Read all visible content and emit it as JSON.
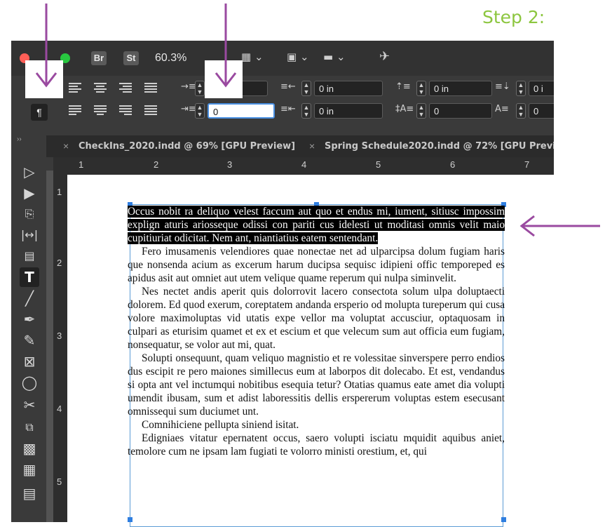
{
  "step_label": "Step 2:",
  "appbar": {
    "bridge_badge": "Br",
    "stock_badge": "St",
    "zoom": "60.3%"
  },
  "control_panel": {
    "left_indent": "0 in",
    "right_indent": "0 in",
    "first_line_indent": "0",
    "last_line_indent": "0 in",
    "space_before": "0 in",
    "space_after": "0 in",
    "drop_cap_lines": "0 i",
    "drop_cap_chars": "0",
    "drop_cap_prefix": "0"
  },
  "tabs": [
    {
      "label": "CheckIns_2020.indd @ 69% [GPU Preview]"
    },
    {
      "label": "Spring Schedule2020.indd @ 72% [GPU Preview"
    }
  ],
  "ruler": {
    "horizontal": [
      "1",
      "2",
      "3",
      "4",
      "5",
      "6",
      "7"
    ],
    "vertical": [
      "1",
      "2",
      "3",
      "4",
      "5"
    ]
  },
  "document": {
    "selected_paragraph": "Occus nobit ra deliquo velest faccum aut quo et endus mi, iument, sitiusc impossim explign aturis ariosseque odissi con pariti cus idelesti ut moditasi omnis velit maio cupitiuriat odicitat. Nem ant, niantiatius eatem sentendant.",
    "paragraphs": [
      "Fero imusamenis velendiores quae nonectae net ad ulparcipsa dolum fugiam haris que nonsenda acium as excerum harum ducipsa sequisc idipieni offic temporeped es apidus asit aut omniet aut utem velique quame reperum qui nulpa siminvelit.",
      "Nes nectet andis aperit quis dolorrovit lacero consectota solum ulpa doluptaecti dolorem. Ed quod exerum, coreptatem andanda ersperio od molupta tureperum qui cusa volore maximoluptas vid utatis expe vellor ma voluptat accusciur, optaquosam in culpari as eturisim quamet et ex et escium et que velecum sum aut officia eum fugiam, nonsequatur, se volor aut mi, quat.",
      "Solupti onsequunt, quam veliquo magnistio et re volessitae sinverspere perro endios dus escipit re pero maiones simillecus eum at laborpos dit dolecabo. Et est, vendandus si opta ant vel inctumqui nobitibus esequia tetur? Otatias quamus eate amet dia volupti umendit ibusam, sum et adist laboressitis dellis erspererum voluptas estem esecusant omnissequi sum duciumet unt.",
      "Comnihiciene pellupta siniend isitat.",
      "Edigniaes vitatur epernatent occus, saero volupti isciatu mquidit aquibus aniet, temolore cum ne ipsam lam fugiati te volorro ministi orestium, et, qui"
    ]
  },
  "icons": {
    "annotation_arrow_color": "#9a4aa0",
    "step_color": "#8cc63f"
  }
}
